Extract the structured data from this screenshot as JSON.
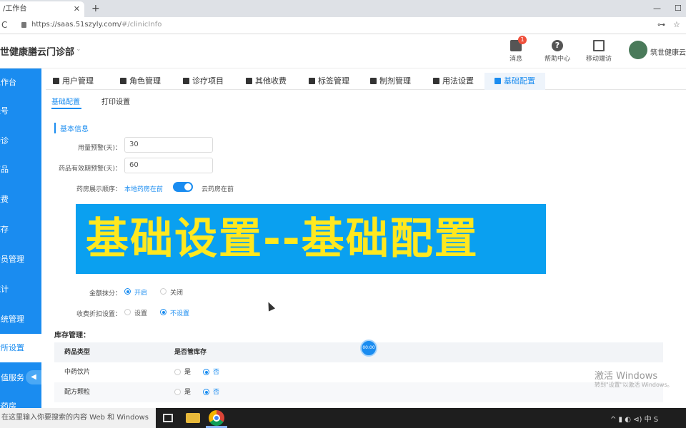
{
  "browser": {
    "tab_title": "/工作台",
    "tab_close": "✕",
    "new_tab": "+",
    "url_host": "https://saas.51szyly.com/",
    "url_path": "#/clinicInfo",
    "reload_icon": "C",
    "window_minimize": "—",
    "window_maximize": "☐",
    "key_icon": "⊶",
    "star_icon": "☆"
  },
  "header": {
    "clinic_name": "世健康膳云门诊部",
    "messages_label": "消息",
    "messages_badge": "1",
    "help_label": "帮助中心",
    "help_glyph": "?",
    "mobile_label": "移动端访",
    "username": "筑世健康云"
  },
  "sidebar": {
    "items": [
      {
        "label": "工作台"
      },
      {
        "label": "挂号"
      },
      {
        "label": "接诊"
      },
      {
        "label": "药品"
      },
      {
        "label": "收费"
      },
      {
        "label": "库存"
      },
      {
        "label": "会员管理"
      },
      {
        "label": "统计"
      },
      {
        "label": "系统管理"
      },
      {
        "label": "诊所设置"
      },
      {
        "label": "增值服务"
      },
      {
        "label": "云药房"
      }
    ],
    "active_index": 9,
    "collapse_glyph": "◀"
  },
  "main": {
    "tabs": [
      {
        "label": "用户管理"
      },
      {
        "label": "角色管理"
      },
      {
        "label": "诊疗项目"
      },
      {
        "label": "其他收费"
      },
      {
        "label": "标签管理"
      },
      {
        "label": "制剂管理"
      },
      {
        "label": "用法设置"
      },
      {
        "label": "基础配置"
      }
    ],
    "active_tab_index": 7,
    "subtabs": [
      {
        "label": "基础配置"
      },
      {
        "label": "打印设置"
      }
    ],
    "section_title": "基本信息",
    "fields": {
      "dosage_warning_label": "用量预警(天)：",
      "dosage_warning_value": "30",
      "expiry_warning_label": "药品有效期预警(天)：",
      "expiry_warning_value": "60",
      "pharmacy_order_label": "药房展示顺序：",
      "pharmacy_order_left": "本地药房在前",
      "pharmacy_order_right": "云药房在前",
      "round_label": "金额抹分：",
      "round_on": "开启",
      "round_off": "关闭",
      "discount_label": "收费折扣设置：",
      "discount_on": "设置",
      "discount_off": "不设置"
    },
    "storage": {
      "title": "库存管理：",
      "columns": [
        "药品类型",
        "是否管库存"
      ],
      "rows": [
        {
          "type": "中药饮片",
          "yes": "是",
          "no": "否"
        },
        {
          "type": "配方颗粒",
          "yes": "是",
          "no": "否"
        }
      ]
    }
  },
  "overlay": {
    "banner_text": "基础设置--基础配置",
    "floating_label": "00:00"
  },
  "watermark": {
    "title": "激活 Windows",
    "subtitle": "转到\"设置\"以激活 Windows。"
  },
  "taskbar": {
    "search_text": "在这里输入你要搜索的内容 Web 和 Windows",
    "tray_text": "^ ▮ ◐ ⊲) 中 S"
  }
}
